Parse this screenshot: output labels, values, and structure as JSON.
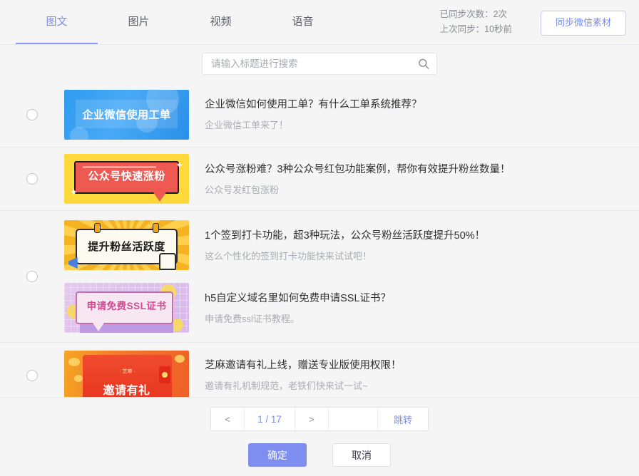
{
  "header": {
    "tabs": [
      {
        "label": "图文",
        "active": true
      },
      {
        "label": "图片",
        "active": false
      },
      {
        "label": "视频",
        "active": false
      },
      {
        "label": "语音",
        "active": false
      }
    ],
    "sync_count_text": "已同步次数：2次",
    "last_sync_text": "上次同步：10秒前",
    "sync_button_label": "同步微信素材"
  },
  "search": {
    "placeholder": "请输入标题进行搜索",
    "value": "",
    "icon": "search-icon"
  },
  "list": {
    "rows": [
      {
        "selected": false,
        "articles": [
          {
            "title": "企业微信如何使用工单？有什么工单系统推荐？",
            "desc": "企业微信工单来了！",
            "thumb_label": "企业微信使用工单",
            "thumb_style": "tn-blue"
          }
        ]
      },
      {
        "selected": false,
        "articles": [
          {
            "title": "公众号涨粉难？3种公众号红包功能案例，帮你有效提升粉丝数量！",
            "desc": "公众号发红包涨粉",
            "thumb_label": "公众号快速涨粉",
            "thumb_style": "tn-yellow"
          }
        ]
      },
      {
        "selected": false,
        "articles": [
          {
            "title": "1个签到打卡功能，超3种玩法，公众号粉丝活跃度提升50%！",
            "desc": "这么个性化的签到打卡功能快来试试吧！",
            "thumb_label": "提升粉丝活跃度",
            "thumb_style": "tn-orange"
          },
          {
            "title": "h5自定义域名里如何免费申请SSL证书？",
            "desc": "申请免费ssl证书教程。",
            "thumb_label": "申请免费SSL证书",
            "thumb_style": "tn-purple"
          }
        ]
      },
      {
        "selected": false,
        "articles": [
          {
            "title": "芝麻邀请有礼上线，赠送专业版使用权限！",
            "desc": "邀请有礼机制规范，老铁们快来试一试~",
            "thumb_label": "邀请有礼",
            "thumb_style": "tn-red"
          }
        ]
      }
    ]
  },
  "pagination": {
    "prev_label": "<",
    "current_label": "1 / 17",
    "next_label": ">",
    "page_input_value": "",
    "jump_label": "跳转"
  },
  "footer": {
    "confirm_label": "确定",
    "cancel_label": "取消"
  },
  "colors": {
    "accent": "#7d8ef0",
    "tab_active": "#7a8cf0",
    "page_bg": "#f5f5f6",
    "text_primary": "#2f3033",
    "text_muted": "#a9acb3"
  }
}
